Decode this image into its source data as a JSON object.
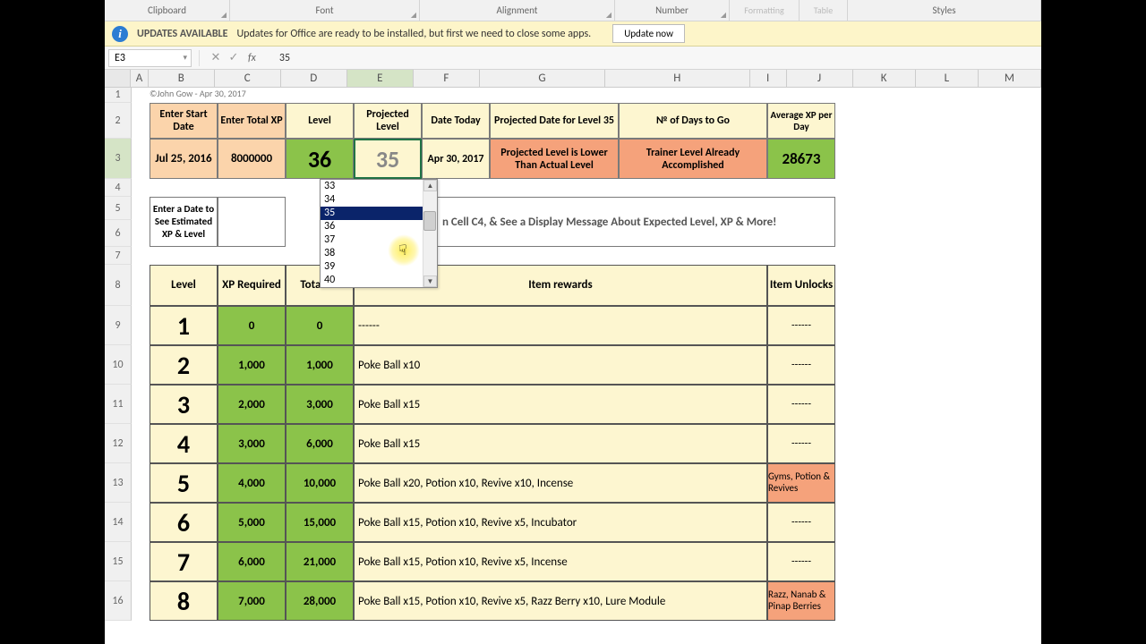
{
  "ribbon": {
    "groups": [
      "Clipboard",
      "Font",
      "Alignment",
      "Number",
      "Formatting",
      "Table",
      "Styles"
    ]
  },
  "msgbar": {
    "title": "UPDATES AVAILABLE",
    "text": "Updates for Office are ready to be installed, but first we need to close some apps.",
    "button": "Update now"
  },
  "namebox": "E3",
  "formula_value": "35",
  "columns": [
    "A",
    "B",
    "C",
    "D",
    "E",
    "F",
    "G",
    "H",
    "I",
    "J",
    "K",
    "L",
    "M"
  ],
  "row_headers": [
    1,
    2,
    3,
    4,
    5,
    6,
    7,
    8,
    9,
    10,
    11,
    12,
    13,
    14,
    15,
    16
  ],
  "copyright": "©John Gow - Apr 30, 2017",
  "hdr": {
    "start_date": "Enter Start Date",
    "total_xp": "Enter Total XP",
    "level": "Level",
    "proj_level": "Projected Level",
    "date_today": "Date Today",
    "proj_date": "Projected Date for Level 35",
    "days_go": "№ of Days to Go",
    "avg_xp": "Average XP per Day"
  },
  "vals": {
    "start_date": "Jul 25, 2016",
    "total_xp": "8000000",
    "level": "36",
    "proj_level": "35",
    "date_today": "Apr 30, 2017",
    "proj_date": "Projected Level is Lower Than Actual Level",
    "days_go": "Trainer Level Already Accomplished",
    "avg_xp": "28673"
  },
  "estimator": {
    "line1": "Enter a Date to",
    "line2": "See Estimated",
    "line3": "XP & Level",
    "msg": "n Cell C4, & See a Display Message About Expected Level, XP & More!"
  },
  "dropdown": {
    "items": [
      "33",
      "34",
      "35",
      "36",
      "37",
      "38",
      "39",
      "40"
    ],
    "selected": "35"
  },
  "table": {
    "headers": {
      "level": "Level",
      "xp_req": "XP Required",
      "total_xp": "Total XP",
      "rewards": "Item rewards",
      "unlocks": "Item Unlocks"
    },
    "rows": [
      {
        "level": "1",
        "xp": "0",
        "total": "0",
        "reward": "------",
        "unlock": "------"
      },
      {
        "level": "2",
        "xp": "1,000",
        "total": "1,000",
        "reward": "Poke Ball x10",
        "unlock": "------"
      },
      {
        "level": "3",
        "xp": "2,000",
        "total": "3,000",
        "reward": "Poke Ball x15",
        "unlock": "------"
      },
      {
        "level": "4",
        "xp": "3,000",
        "total": "6,000",
        "reward": "Poke Ball x15",
        "unlock": "------"
      },
      {
        "level": "5",
        "xp": "4,000",
        "total": "10,000",
        "reward": "Poke Ball x20, Potion x10, Revive x10, Incense",
        "unlock": "Gyms, Potion & Revives",
        "special": true
      },
      {
        "level": "6",
        "xp": "5,000",
        "total": "15,000",
        "reward": "Poke Ball x15, Potion x10, Revive x5, Incubator",
        "unlock": "------"
      },
      {
        "level": "7",
        "xp": "6,000",
        "total": "21,000",
        "reward": "Poke Ball x15, Potion x10, Revive x5, Incense",
        "unlock": "------"
      },
      {
        "level": "8",
        "xp": "7,000",
        "total": "28,000",
        "reward": "Poke Ball x15, Potion x10, Revive x5, Razz Berry x10, Lure Module",
        "unlock": "Razz, Nanab & Pinap Berries",
        "special": true
      }
    ]
  }
}
